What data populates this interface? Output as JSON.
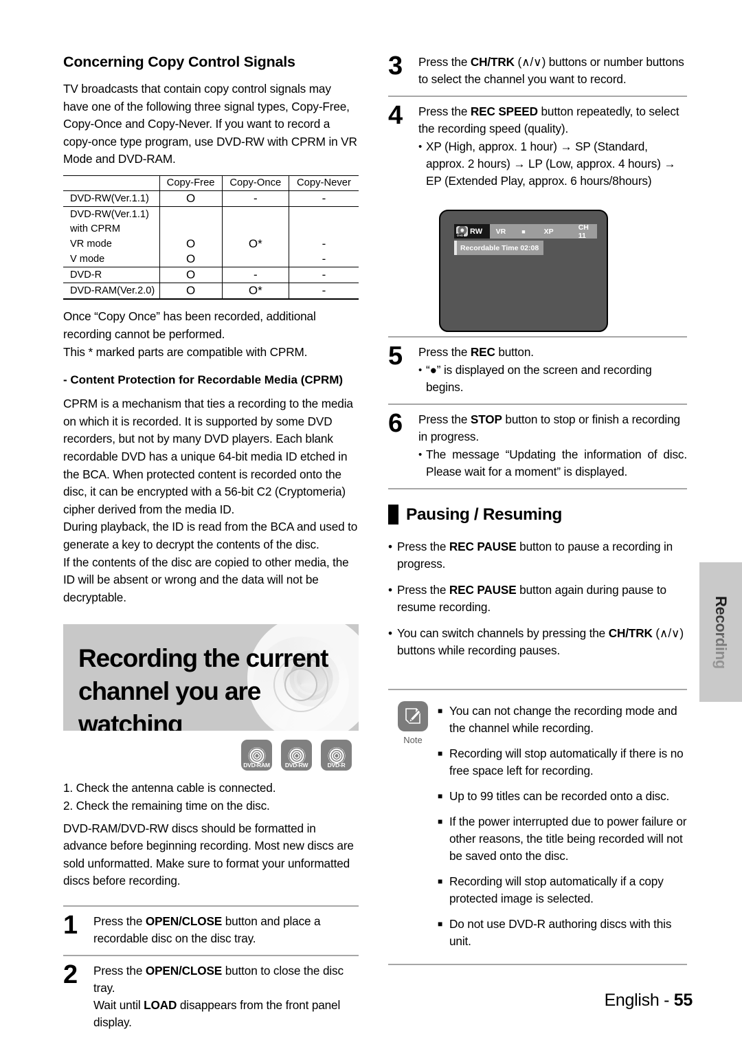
{
  "left": {
    "section_title": "Concerning Copy Control Signals",
    "intro_paragraph": "TV broadcasts that contain copy control signals may have one of the following three signal types, Copy-Free, Copy-Once and Copy-Never. If you want to record a copy-once type program, use DVD-RW with CPRM in VR Mode and DVD-RAM.",
    "table": {
      "columns": [
        "",
        "Copy-Free",
        "Copy-Once",
        "Copy-Never"
      ],
      "rows": [
        {
          "label": "DVD-RW(Ver.1.1)",
          "cells": [
            "O",
            "-",
            "-"
          ]
        },
        {
          "label": "DVD-RW(Ver.1.1)",
          "cells": [
            "",
            "",
            ""
          ]
        },
        {
          "label": "with CPRM",
          "cells": [
            "",
            "",
            ""
          ]
        },
        {
          "label": "VR mode",
          "cells": [
            "O",
            "O*",
            "-"
          ]
        },
        {
          "label": "V mode",
          "cells": [
            "O",
            "",
            "-"
          ]
        },
        {
          "label": "DVD-R",
          "cells": [
            "O",
            "-",
            "-"
          ]
        },
        {
          "label": "DVD-RAM(Ver.2.0)",
          "cells": [
            "O",
            "O*",
            "-"
          ]
        }
      ]
    },
    "after_table_1": "Once “Copy Once” has been recorded, additional recording cannot be performed.",
    "after_table_2": "This * marked parts are compatible with CPRM.",
    "cprm_heading": "- Content Protection for Recordable Media (CPRM)",
    "cprm_p1": "CPRM is a mechanism that ties a recording to the media on which it is recorded. It is supported by some DVD recorders, but not by many DVD players. Each blank recordable DVD has a unique 64-bit media ID etched in the BCA. When protected content is recorded onto the disc, it can be encrypted with a 56-bit C2 (Cryptomeria) cipher derived from the media ID.",
    "cprm_p2": "During playback, the ID is read from the BCA and used to generate a key to decrypt the contents of the disc.",
    "cprm_p3": "If the contents of the disc are copied to other media, the ID will be absent or wrong and the data will not be decryptable.",
    "banner_title_line1": "Recording the current",
    "banner_title_line2": "channel you are watching",
    "media_icons": [
      {
        "name": "dvd-ram-icon",
        "label": "DVD-RAM"
      },
      {
        "name": "dvd-rw-icon",
        "label": "DVD-RW"
      },
      {
        "name": "dvd-r-icon",
        "label": "DVD-R"
      }
    ],
    "prep_1": "1. Check the antenna cable is connected.",
    "prep_2": "2. Check the remaining time on the disc.",
    "prep_paragraph": "DVD-RAM/DVD-RW discs should be formatted in advance before beginning recording. Most new discs are sold unformatted. Make sure to format your unformatted discs before recording.",
    "step1": {
      "num": "1",
      "pre": "Press the ",
      "bold": "OPEN/CLOSE",
      "post": " button and place a recordable disc on the disc tray."
    },
    "step2": {
      "num": "2",
      "pre": "Press the ",
      "bold": "OPEN/CLOSE",
      "post": " button to close the disc tray.",
      "line2_pre": "Wait until ",
      "line2_bold": "LOAD",
      "line2_post": " disappears from the front panel display."
    }
  },
  "right": {
    "step3": {
      "num": "3",
      "pre": "Press the ",
      "bold": "CH/TRK",
      "post": " (∧/∨) buttons or number buttons to select the channel you want to record."
    },
    "step4": {
      "num": "4",
      "pre": "Press the ",
      "bold": "REC SPEED",
      "post": " button repeatedly, to select the recording speed (quality).",
      "bullet": "XP (High, approx. 1 hour) → SP (Standard, approx. 2 hours) → LP (Low, approx. 4 hours) → EP (Extended Play, approx. 6 hours/8hours)"
    },
    "osd": {
      "disc_type": "RW",
      "disc_mark": "DVD",
      "mode": "VR",
      "state_icon": "stop-icon",
      "speed": "XP",
      "channel": "CH 11",
      "recordable_time": "Recordable Time 02:08"
    },
    "step5": {
      "num": "5",
      "pre": "Press the ",
      "bold": "REC",
      "post": " button.",
      "bullet": "“●” is displayed on the screen and recording begins."
    },
    "step6": {
      "num": "6",
      "pre": "Press the ",
      "bold": "STOP",
      "post": " button to stop or finish a recording in progress.",
      "bullet": "The message “Updating the information of disc. Please wait for a moment” is displayed."
    },
    "pausing": {
      "heading": "Pausing / Resuming",
      "bullets": [
        {
          "pre": "Press the ",
          "bold": "REC PAUSE",
          "post": " button to pause a recording in progress."
        },
        {
          "pre": "Press the ",
          "bold": "REC PAUSE",
          "post": " button again during pause to resume recording."
        },
        {
          "pre": "You can switch channels by pressing the ",
          "bold": "CH/TRK",
          "post": " (∧/∨) buttons while recording pauses."
        }
      ]
    },
    "note": {
      "label": "Note",
      "items": [
        "You can not change the recording mode and the channel while recording.",
        "Recording will stop automatically if there is no free space left for recording.",
        "Up to 99 titles can be recorded onto a disc.",
        "If the power interrupted due to power failure or other reasons, the title being recorded will not be saved onto the disc.",
        "Recording will stop automatically if a copy protected image is selected.",
        "Do not use DVD-R authoring discs with this unit."
      ]
    }
  },
  "sidetab": {
    "label": "Recording"
  },
  "footer": {
    "language": "English - ",
    "page": "55"
  }
}
